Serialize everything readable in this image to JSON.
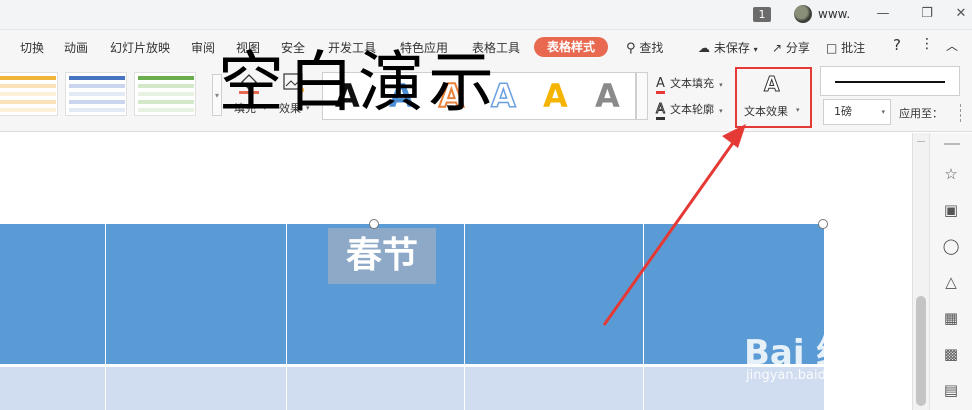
{
  "titlebar": {
    "badge": "1",
    "user": "www.",
    "minimize": "—",
    "restore": "❐",
    "close": "✕"
  },
  "menu": {
    "tabs": [
      "切换",
      "动画",
      "幻灯片放映",
      "审阅",
      "视图",
      "安全",
      "开发工具",
      "特色应用",
      "表格工具"
    ],
    "active_tab": "表格样式",
    "search": "查找",
    "unsaved": "未保存",
    "share": "分享",
    "comment": "批注",
    "help": "?",
    "more": "⋮",
    "collapse": "︿"
  },
  "ribbon": {
    "fill_label": "填充",
    "effect_label": "效果",
    "text_fill": "文本填充",
    "text_outline": "文本轮廓",
    "text_effect": "文本效果",
    "wordart_letter": "A",
    "line_size": "1磅",
    "apply_to": "应用至："
  },
  "slide": {
    "title": "空白演示",
    "cell_text": "春节"
  },
  "watermark": {
    "brand": "Bai 经验",
    "url": "jingyan.baidu.com"
  },
  "colors": {
    "accent": "#e8694f",
    "table_header": "#5b9bd5",
    "table_row": "#d0dcef",
    "highlight": "#e53935",
    "arrow": "#e53935"
  },
  "icons": {
    "search": "search-icon",
    "cloud": "cloud-icon",
    "share": "share-icon",
    "comment": "comment-icon",
    "fill": "paint-bucket-icon",
    "effect": "image-effect-icon",
    "text_fill": "text-fill-icon",
    "text_outline": "text-outline-icon",
    "text_effect": "text-effect-icon"
  }
}
